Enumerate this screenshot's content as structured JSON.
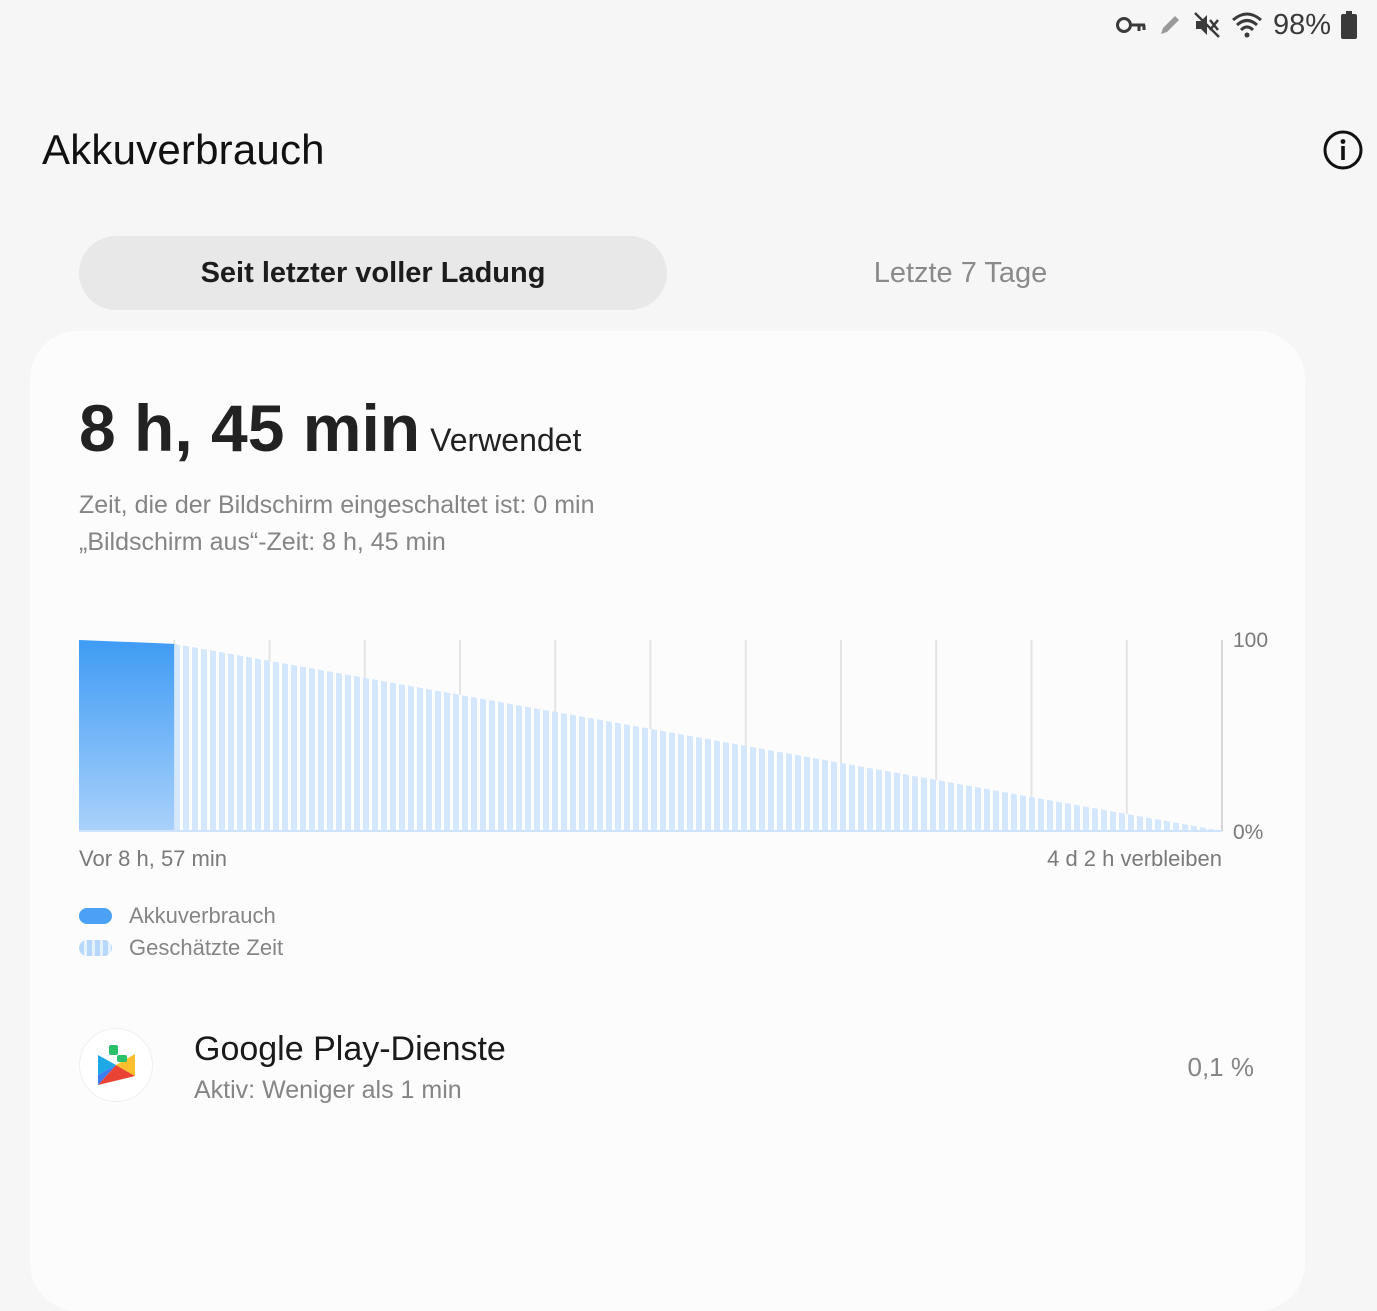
{
  "status_bar": {
    "icons": [
      "key-icon",
      "pen-icon",
      "mute-icon",
      "wifi-icon",
      "battery-icon"
    ],
    "battery_percent": "98%"
  },
  "header": {
    "title": "Akkuverbrauch",
    "info_icon": "info-icon"
  },
  "tabs": [
    {
      "label": "Seit letzter voller Ladung",
      "active": true
    },
    {
      "label": "Letzte 7 Tage",
      "active": false
    }
  ],
  "summary": {
    "used_time": "8 h, 45 min",
    "used_label": "Verwendet",
    "screen_on": "Zeit, die der Bildschirm eingeschaltet ist: 0 min",
    "screen_off": "„Bildschirm aus“-Zeit: 8 h, 45 min"
  },
  "chart_data": {
    "type": "area",
    "y_ticks": [
      "100",
      "0%"
    ],
    "ylim": [
      0,
      100
    ],
    "x_start_label": "Vor 8 h, 57 min",
    "x_end_label": "4 d 2 h verbleiben",
    "series": [
      {
        "name": "Akkuverbrauch",
        "x": [
          0,
          1
        ],
        "values": [
          100,
          98
        ],
        "color": "#4aa1f5"
      },
      {
        "name": "Geschätzte Zeit",
        "x": [
          1,
          12
        ],
        "values": [
          98,
          0
        ],
        "color": "#b7d8fb"
      }
    ],
    "grid": true
  },
  "legend": [
    {
      "label": "Akkuverbrauch",
      "color": "#4aa1f5"
    },
    {
      "label": "Geschätzte Zeit",
      "color": "#b7d8fb"
    }
  ],
  "apps": [
    {
      "name": "Google Play-Dienste",
      "detail": "Aktiv: Weniger als 1 min",
      "percent": "0,1 %",
      "icon": "google-play-services-icon"
    }
  ]
}
